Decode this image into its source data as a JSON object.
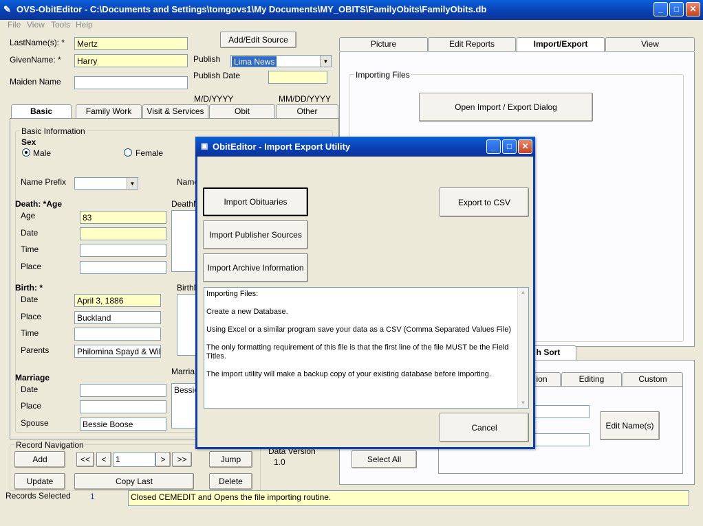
{
  "window": {
    "title": "OVS-ObitEditor - C:\\Documents and Settings\\tomgovs1\\My Documents\\MY_OBITS\\FamilyObits\\FamilyObits.db"
  },
  "menu": [
    "File",
    "View",
    "Tools",
    "Help"
  ],
  "header": {
    "lastname_label": "LastName(s): *",
    "lastname_value": "Mertz",
    "givenname_label": "GivenName: *",
    "givenname_value": "Harry",
    "maiden_label": "Maiden Name",
    "maiden_value": "",
    "add_edit_source": "Add/Edit Source",
    "publish_label": "Publish",
    "publish_value": "Lima News",
    "publish_date_label": "Publish Date",
    "publish_date_value": "",
    "format_md": "M/D/YYYY",
    "format_mmdd": "MM/DD/YYYY"
  },
  "left_tabs": [
    "Basic",
    "Family Work",
    "Visit & Services",
    "Obit",
    "Other"
  ],
  "basic": {
    "group_title": "Basic Information",
    "sex_label": "Sex",
    "male": "Male",
    "female": "Female",
    "name_prefix_label": "Name Prefix",
    "name_suffix_partial": "Name",
    "death_label": "Death: *Age",
    "age_label": "Age",
    "age_value": "83",
    "date_label": "Date",
    "death_date_value": "",
    "time_label": "Time",
    "death_time_value": "",
    "place_label": "Place",
    "death_place_value": "",
    "death_notes_partial": "DeathN",
    "birth_label": "Birth: *",
    "birth_date_value": "April 3, 1886",
    "birth_place_value": "Buckland",
    "birth_time_value": "",
    "parents_label": "Parents",
    "parents_value": "Philomina Spayd & Willia",
    "birth_notes_partial": "BirthN",
    "marriage_label": "Marriage",
    "marriage_date_value": "",
    "marriage_place_value": "",
    "spouse_label": "Spouse",
    "spouse_value": "Bessie Boose",
    "marriage_notes_partial": "Marria",
    "marriage_notes_value": "Bessie"
  },
  "right_tabs": [
    "Picture",
    "Edit Reports",
    "Import/Export",
    "View"
  ],
  "import_export": {
    "group_title": "Importing Files",
    "open_dialog": "Open Import / Export Dialog"
  },
  "lower_right": {
    "tab_partial": "h Sort",
    "sub_tabs": [
      "ion",
      "Editing",
      "Custom"
    ],
    "edit_names": "Edit Name(s)",
    "select_all": "Select All"
  },
  "record_nav": {
    "title": "Record Navigation",
    "add": "Add",
    "first": "<<",
    "prev": "<",
    "record": "1",
    "next": ">",
    "last": ">>",
    "jump": "Jump",
    "update": "Update",
    "copy_last": "Copy Last",
    "delete": "Delete",
    "data_version_label": "Data Version",
    "data_version_value": "1.0"
  },
  "status": {
    "records_selected_label": "Records Selected",
    "records_selected_value": "1",
    "message": "Closed CEMEDIT and Opens the file importing routine."
  },
  "dialog": {
    "title": "ObitEditor - Import Export Utility",
    "import_obits": "Import Obituaries",
    "import_publisher": "Import Publisher Sources",
    "import_archive": "Import Archive Information",
    "export_csv": "Export to CSV",
    "cancel": "Cancel",
    "help_lines": [
      "Importing Files:",
      "Create a new Database.",
      "Using Excel or a similar program save your data as a CSV (Comma Separated Values File)",
      "The only formatting requirement of this file is that the first line of the file MUST be the Field Titles.",
      "The import utility will make a backup copy of your existing database before importing."
    ]
  }
}
